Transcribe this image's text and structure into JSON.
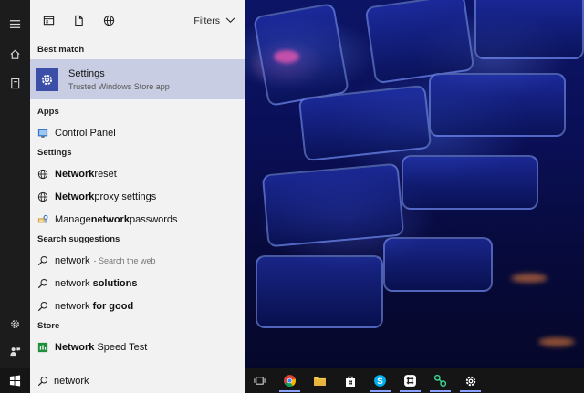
{
  "panel": {
    "filters_label": "Filters",
    "best_match": {
      "section": "Best match",
      "title": "Settings",
      "subtitle": "Trusted Windows Store app"
    },
    "apps": {
      "section": "Apps",
      "items": [
        {
          "label": "Control Panel"
        }
      ]
    },
    "settings": {
      "section": "Settings",
      "items": [
        {
          "bold": "Network",
          "rest": " reset"
        },
        {
          "bold": "Network",
          "rest": " proxy settings"
        },
        {
          "pre": "Manage ",
          "bold": "network",
          "rest": " passwords"
        }
      ]
    },
    "suggestions": {
      "section": "Search suggestions",
      "items": [
        {
          "text": "network",
          "hint": "- Search the web"
        },
        {
          "text": "network ",
          "bold": "solutions"
        },
        {
          "text": "network ",
          "bold": "for good"
        }
      ]
    },
    "store": {
      "section": "Store",
      "items": [
        {
          "bold": "Network",
          "rest": " Speed Test"
        }
      ]
    }
  },
  "search": {
    "value": "network"
  },
  "taskbar": {
    "items": [
      "task-view-icon",
      "chrome-icon",
      "file-explorer-icon",
      "store-icon",
      "skype-icon",
      "slack-icon",
      "network-app-icon",
      "settings-icon"
    ]
  },
  "colors": {
    "accent": "#3b4fa8",
    "selection": "#c9cde3",
    "panel_bg": "#f2f2f2",
    "rail_bg": "#1c1c1c",
    "taskbar_bg": "#151515"
  }
}
